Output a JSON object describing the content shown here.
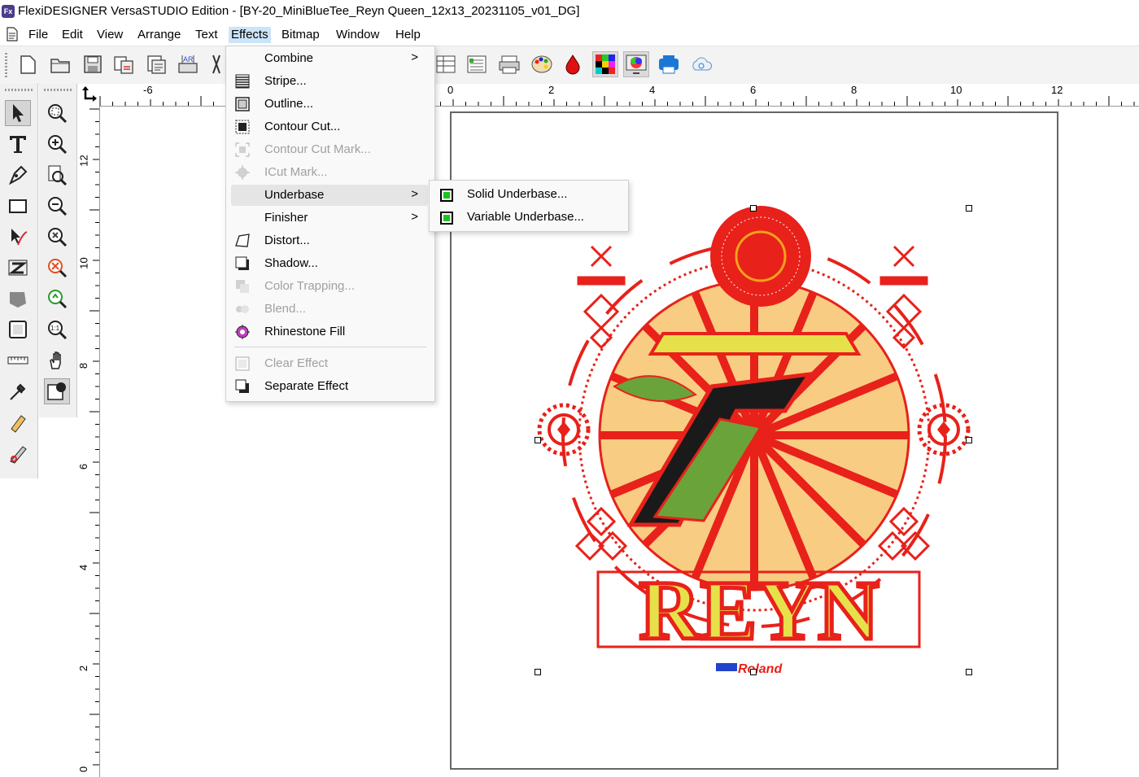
{
  "window": {
    "app_icon_text": "Fx",
    "title": "FlexiDESIGNER VersaSTUDIO Edition - [BY-20_MiniBlueTee_Reyn Queen_12x13_20231105_v01_DG]"
  },
  "menubar": {
    "items": [
      "File",
      "Edit",
      "View",
      "Arrange",
      "Text",
      "Effects",
      "Bitmap",
      "Window",
      "Help"
    ],
    "active": "Effects"
  },
  "effects_menu": {
    "items": [
      {
        "label": "Combine",
        "icon": "none",
        "submenu": true,
        "disabled": false
      },
      {
        "label": "Stripe...",
        "icon": "stripe-icon",
        "submenu": false,
        "disabled": false
      },
      {
        "label": "Outline...",
        "icon": "outline-icon",
        "submenu": false,
        "disabled": false
      },
      {
        "label": "Contour Cut...",
        "icon": "contour-cut-icon",
        "submenu": false,
        "disabled": false
      },
      {
        "label": "Contour Cut Mark...",
        "icon": "contour-cut-mark-icon",
        "submenu": false,
        "disabled": true
      },
      {
        "label": "ICut Mark...",
        "icon": "icut-mark-icon",
        "submenu": false,
        "disabled": true
      },
      {
        "label": "Underbase",
        "icon": "none",
        "submenu": true,
        "disabled": false,
        "highlighted": true
      },
      {
        "label": "Finisher",
        "icon": "none",
        "submenu": true,
        "disabled": false
      },
      {
        "label": "Distort...",
        "icon": "distort-icon",
        "submenu": false,
        "disabled": false
      },
      {
        "label": "Shadow...",
        "icon": "shadow-icon",
        "submenu": false,
        "disabled": false
      },
      {
        "label": "Color Trapping...",
        "icon": "color-trapping-icon",
        "submenu": false,
        "disabled": true
      },
      {
        "label": "Blend...",
        "icon": "blend-icon",
        "submenu": false,
        "disabled": true
      },
      {
        "label": "Rhinestone Fill",
        "icon": "rhinestone-fill-icon",
        "submenu": false,
        "disabled": false
      },
      {
        "label": "Clear Effect",
        "icon": "clear-effect-icon",
        "submenu": false,
        "disabled": true
      },
      {
        "label": "Separate Effect",
        "icon": "separate-effect-icon",
        "submenu": false,
        "disabled": false
      }
    ]
  },
  "underbase_submenu": {
    "items": [
      {
        "label": "Solid Underbase...",
        "icon": "underbase-icon"
      },
      {
        "label": "Variable Underbase...",
        "icon": "underbase-icon"
      }
    ]
  },
  "rulers": {
    "horizontal_labels": [
      "-6",
      "0",
      "2",
      "4",
      "6",
      "8",
      "10",
      "12"
    ],
    "vertical_labels": [
      "12",
      "10",
      "8",
      "6",
      "4",
      "2",
      "0"
    ]
  },
  "artwork": {
    "main_text": "REYN",
    "brand_text": "Roland",
    "colors": {
      "red": "#e8211a",
      "yellow": "#e6e14a",
      "green": "#6aa33a",
      "orange": "#f3a21c"
    }
  },
  "colors": {
    "menu_highlight": "#cce4f7",
    "menu_hover": "#e5e5e5",
    "underbase_green": "#1ec21e"
  }
}
